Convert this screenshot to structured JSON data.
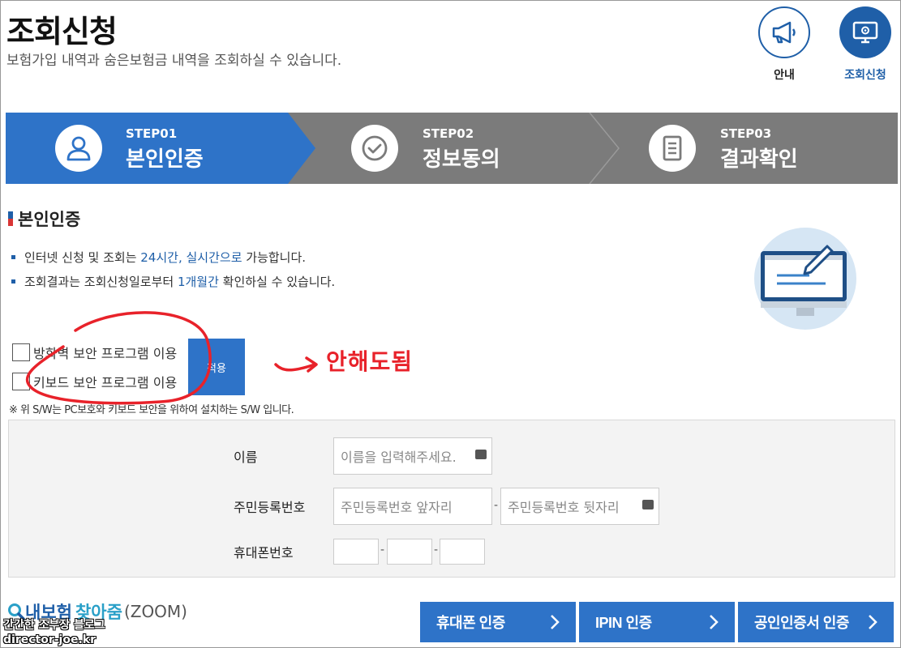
{
  "header": {
    "title": "조회신청",
    "subtitle": "보험가입 내역과 숨은보험금 내역을 조회하실 수 있습니다.",
    "guide_label": "안내",
    "apply_label": "조회신청"
  },
  "steps": [
    {
      "num": "STEP01",
      "name": "본인인증",
      "icon": "user-icon",
      "active": true
    },
    {
      "num": "STEP02",
      "name": "정보동의",
      "icon": "check-circle-icon",
      "active": false
    },
    {
      "num": "STEP03",
      "name": "결과확인",
      "icon": "document-icon",
      "active": false
    }
  ],
  "section": {
    "title": "본인인증",
    "bullet1_pre": "인터넷 신청 및 조회는 ",
    "bullet1_hl": "24시간, 실시간으로",
    "bullet1_post": " 가능합니다.",
    "bullet2_pre": "조회결과는 조회신청일로부터 ",
    "bullet2_hl": "1개월간",
    "bullet2_post": " 확인하실 수 있습니다."
  },
  "security": {
    "firewall_label": "방화벽 보안 프로그램 이용",
    "keyboard_label": "키보드 보안 프로그램 이용",
    "apply_button": "적용",
    "note": "※ 위 S/W는 PC보호와 키보드 보안을 위하여 설치하는 S/W 입니다."
  },
  "annotation": {
    "text": "안해도됨"
  },
  "form": {
    "name_label": "이름",
    "name_placeholder": "이름을 입력해주세요.",
    "rrn_label": "주민등록번호",
    "rrn_front_placeholder": "주민등록번호 앞자리",
    "rrn_back_placeholder": "주민등록번호 뒷자리",
    "phone_label": "휴대폰번호",
    "dash": "-"
  },
  "footer": {
    "logo_a": "내보험",
    "logo_b": "찾아줌",
    "logo_c": "(ZOOM)",
    "auth_phone": "휴대폰 인증",
    "auth_ipin": "IPIN 인증",
    "auth_cert": "공인인증서 인증"
  },
  "watermark": {
    "line1": "간간한 조부장 블로그",
    "line2": "director-joe.kr"
  },
  "colors": {
    "primary": "#1f5fa8",
    "step_active": "#2e73c8",
    "step_inactive": "#7b7b7b",
    "annotation": "#e8222a"
  }
}
